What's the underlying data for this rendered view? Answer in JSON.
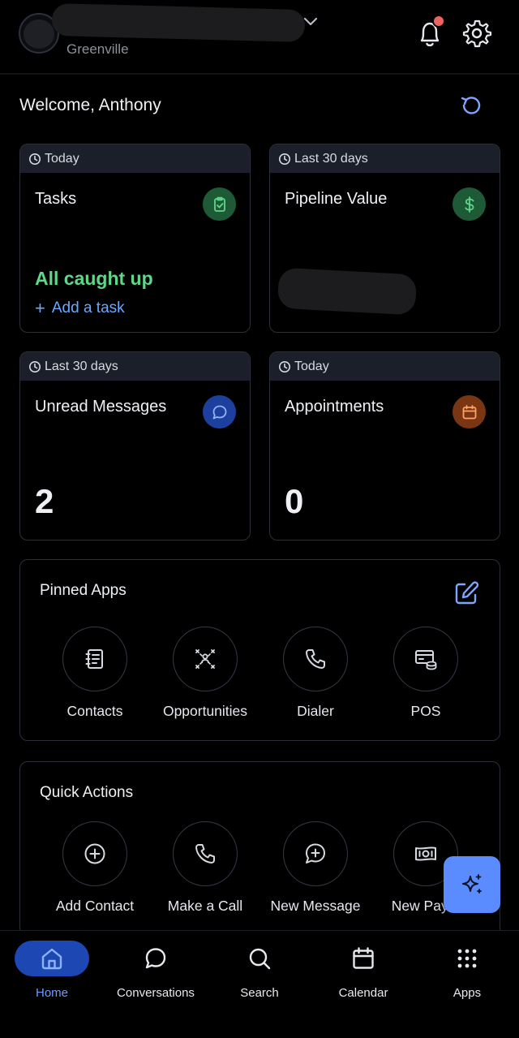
{
  "header": {
    "location": "Greenville",
    "notification_badge": true
  },
  "welcome": {
    "text": "Welcome, Anthony"
  },
  "cards": [
    {
      "range": "Today",
      "title": "Tasks",
      "status": "All caught up",
      "action": "Add a task",
      "icon": "clipboard-check-icon",
      "icon_bg": "#1f5a36",
      "icon_color": "#5fd68a"
    },
    {
      "range": "Last 30 days",
      "title": "Pipeline Value",
      "value": "",
      "icon": "dollar-icon",
      "icon_bg": "#1f5a36",
      "icon_color": "#5fd68a"
    },
    {
      "range": "Last 30 days",
      "title": "Unread Messages",
      "value": "2",
      "icon": "chat-bubble-icon",
      "icon_bg": "#1d3f9e",
      "icon_color": "#8fb3ff"
    },
    {
      "range": "Today",
      "title": "Appointments",
      "value": "0",
      "icon": "calendar-icon",
      "icon_bg": "#7a3512",
      "icon_color": "#ffa266"
    }
  ],
  "pinned_apps": {
    "title": "Pinned Apps",
    "items": [
      {
        "label": "Contacts",
        "icon": "contacts-book-icon"
      },
      {
        "label": "Opportunities",
        "icon": "opportunities-icon"
      },
      {
        "label": "Dialer",
        "icon": "phone-icon"
      },
      {
        "label": "POS",
        "icon": "pos-icon"
      }
    ]
  },
  "quick_actions": {
    "title": "Quick Actions",
    "items": [
      {
        "label": "Add Contact",
        "icon": "plus-circle-icon"
      },
      {
        "label": "Make a Call",
        "icon": "phone-icon"
      },
      {
        "label": "New Message",
        "icon": "message-plus-icon"
      },
      {
        "label": "New Paym",
        "icon": "money-icon"
      }
    ]
  },
  "bottom_nav": {
    "items": [
      {
        "label": "Home",
        "icon": "home-icon",
        "active": true
      },
      {
        "label": "Conversations",
        "icon": "chat-bubble-icon",
        "active": false
      },
      {
        "label": "Search",
        "icon": "search-icon",
        "active": false
      },
      {
        "label": "Calendar",
        "icon": "calendar-icon",
        "active": false
      },
      {
        "label": "Apps",
        "icon": "grid-icon",
        "active": false
      }
    ]
  },
  "colors": {
    "accent": "#6f9bff",
    "active_nav_bg": "#1d48b3",
    "success": "#5fd68a",
    "fab_bg": "#5b8cff"
  }
}
